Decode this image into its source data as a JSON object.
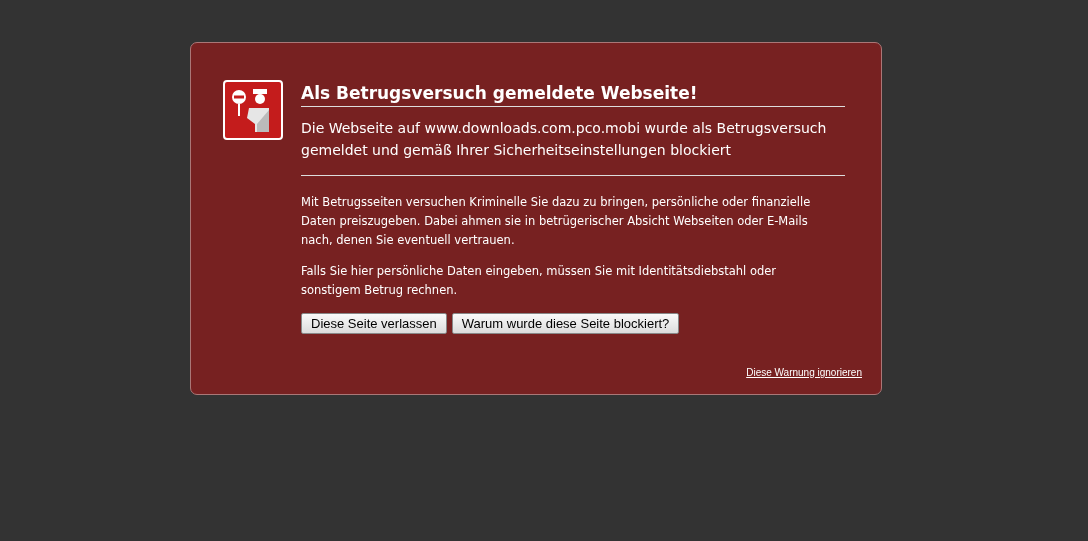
{
  "warning": {
    "title": "Als Betrugsversuch gemeldete Webseite!",
    "summary": "Die Webseite auf www.downloads.com.pco.mobi wurde als Betrugsversuch gemeldet und gemäß Ihrer Sicherheitseinstellungen blockiert",
    "paragraphs": [
      "Mit Betrugsseiten versuchen Kriminelle Sie dazu zu bringen, persönliche oder finanzielle Daten preiszugeben. Dabei ahmen sie in betrügerischer Absicht Webseiten oder E-Mails nach, denen Sie eventuell vertrauen.",
      "Falls Sie hier persönliche Daten eingeben, müssen Sie mit Identitätsdiebstahl oder sonstigem Betrug rechnen."
    ],
    "buttons": [
      "Diese Seite verlassen",
      "Warum wurde diese Seite blockiert?"
    ],
    "ignore_link": "Diese Warnung ignorieren"
  }
}
